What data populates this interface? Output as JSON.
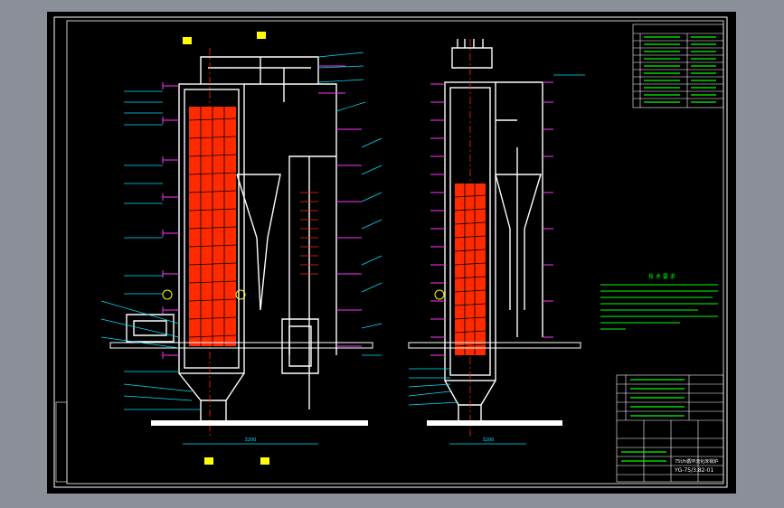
{
  "colors": {
    "background": "#000000",
    "viewport_frame": "#8b9098",
    "border": "#ffffff",
    "leader_lines": "#00e5ff",
    "level_marks": "#ff33ff",
    "furnace_tubes": "#ff2a00",
    "notes_text": "#00ff00",
    "title_block_text": "#00ff00",
    "structure": "#ffffff",
    "centerline": "#ff2a00",
    "equipment_markers": "#ffff00"
  },
  "drawing": {
    "tech_requirements_heading": "技 术 要 求",
    "drawing_number": "YG-75/3.82-01",
    "title_block_label": "75t/h循环流化床锅炉",
    "dimension_width_front": "3200",
    "dimension_width_side": "3200"
  }
}
